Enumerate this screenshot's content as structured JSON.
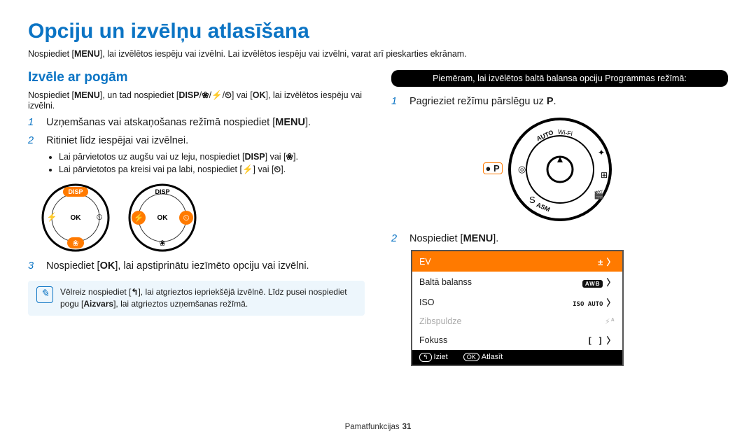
{
  "title": "Opciju un izvēlņu atlasīšana",
  "intro_pre": "Nospiediet [",
  "intro_menu": "MENU",
  "intro_post": "], lai izvēlētos iespēju vai izvēlni. Lai izvēlētos iespēju vai izvēlni, varat arī pieskarties ekrānam.",
  "left": {
    "h2": "Izvēle ar pogām",
    "sub_pre": "Nospiediet [",
    "sub_menu": "MENU",
    "sub_mid": "], un tad nospiediet [",
    "sub_disp": "DISP",
    "sub_slash1": "/",
    "sub_flower": "❀",
    "sub_slash2": "/",
    "sub_flash": "⚡",
    "sub_slash3": "/",
    "sub_timer": "⏲",
    "sub_mid2": "] vai [",
    "sub_ok": "OK",
    "sub_post": "], lai izvēlētos iespēju vai izvēlni.",
    "step1_pre": "Uzņemšanas vai atskaņošanas režīmā nospiediet [",
    "step1_menu": "MENU",
    "step1_post": "].",
    "step2": "Ritiniet līdz iespējai vai izvēlnei.",
    "bullet1_pre": "Lai pārvietotos uz augšu vai uz leju, nospiediet [",
    "bullet1_d": "DISP",
    "bullet1_mid": "] vai [",
    "bullet1_f": "❀",
    "bullet1_post": "].",
    "bullet2_pre": "Lai pārvietotos pa kreisi vai pa labi, nospiediet [",
    "bullet2_a": "⚡",
    "bullet2_mid": "] vai [",
    "bullet2_b": "⏲",
    "bullet2_post": "].",
    "wheel_disp": "DISP",
    "wheel_ok": "OK",
    "step3_pre": "Nospiediet [",
    "step3_ok": "OK",
    "step3_post": "], lai apstiprinātu iezīmēto opciju vai izvēlni.",
    "tip_pre": "Vēlreiz nospiediet [",
    "tip_back": "↰",
    "tip_mid": "], lai atgrieztos iepriekšējā izvēlnē. Līdz pusei nospiediet pogu [",
    "tip_bold": "Aizvars",
    "tip_post": "], lai atgrieztos uzņemšanas režīmā."
  },
  "right": {
    "pill": "Piemēram, lai izvēlētos baltā balansa opciju Programmas režīmā:",
    "step1_pre": "Pagrieziet režīmu pārslēgu uz ",
    "step1_p": "P",
    "step1_post": ".",
    "p_marker_dot": "●",
    "p_marker_p": "P",
    "dial_auto": "AUTO",
    "dial_wifi": "Wi-Fi",
    "dial_asm": "ASM",
    "step2_pre": "Nospiediet [",
    "step2_menu": "MENU",
    "step2_post": "].",
    "lcd": {
      "r1": "EV",
      "v1": "±",
      "r2": "Baltā balanss",
      "v2": "AWB",
      "r3": "ISO",
      "v3": "ISO AUTO",
      "r4": "Zibspuldze",
      "v4": "⚡ᴬ",
      "r5": "Fokuss",
      "v5": "[ ]",
      "foot1_k": "↰",
      "foot1": "Iziet",
      "foot2_k": "OK",
      "foot2": "Atlasīt"
    }
  },
  "footer_label": "Pamatfunkcijas",
  "footer_page": "31"
}
